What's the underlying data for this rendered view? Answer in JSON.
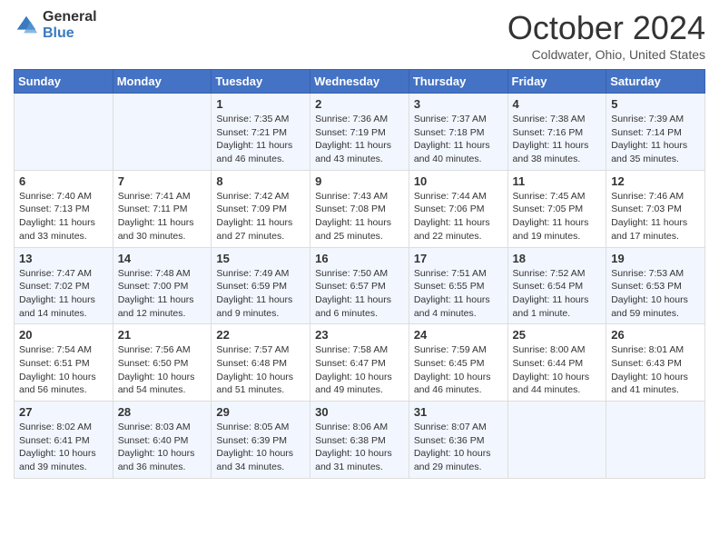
{
  "header": {
    "logo_general": "General",
    "logo_blue": "Blue",
    "title": "October 2024",
    "location": "Coldwater, Ohio, United States"
  },
  "days_of_week": [
    "Sunday",
    "Monday",
    "Tuesday",
    "Wednesday",
    "Thursday",
    "Friday",
    "Saturday"
  ],
  "weeks": [
    [
      {
        "day": "",
        "content": ""
      },
      {
        "day": "",
        "content": ""
      },
      {
        "day": "1",
        "content": "Sunrise: 7:35 AM\nSunset: 7:21 PM\nDaylight: 11 hours and 46 minutes."
      },
      {
        "day": "2",
        "content": "Sunrise: 7:36 AM\nSunset: 7:19 PM\nDaylight: 11 hours and 43 minutes."
      },
      {
        "day": "3",
        "content": "Sunrise: 7:37 AM\nSunset: 7:18 PM\nDaylight: 11 hours and 40 minutes."
      },
      {
        "day": "4",
        "content": "Sunrise: 7:38 AM\nSunset: 7:16 PM\nDaylight: 11 hours and 38 minutes."
      },
      {
        "day": "5",
        "content": "Sunrise: 7:39 AM\nSunset: 7:14 PM\nDaylight: 11 hours and 35 minutes."
      }
    ],
    [
      {
        "day": "6",
        "content": "Sunrise: 7:40 AM\nSunset: 7:13 PM\nDaylight: 11 hours and 33 minutes."
      },
      {
        "day": "7",
        "content": "Sunrise: 7:41 AM\nSunset: 7:11 PM\nDaylight: 11 hours and 30 minutes."
      },
      {
        "day": "8",
        "content": "Sunrise: 7:42 AM\nSunset: 7:09 PM\nDaylight: 11 hours and 27 minutes."
      },
      {
        "day": "9",
        "content": "Sunrise: 7:43 AM\nSunset: 7:08 PM\nDaylight: 11 hours and 25 minutes."
      },
      {
        "day": "10",
        "content": "Sunrise: 7:44 AM\nSunset: 7:06 PM\nDaylight: 11 hours and 22 minutes."
      },
      {
        "day": "11",
        "content": "Sunrise: 7:45 AM\nSunset: 7:05 PM\nDaylight: 11 hours and 19 minutes."
      },
      {
        "day": "12",
        "content": "Sunrise: 7:46 AM\nSunset: 7:03 PM\nDaylight: 11 hours and 17 minutes."
      }
    ],
    [
      {
        "day": "13",
        "content": "Sunrise: 7:47 AM\nSunset: 7:02 PM\nDaylight: 11 hours and 14 minutes."
      },
      {
        "day": "14",
        "content": "Sunrise: 7:48 AM\nSunset: 7:00 PM\nDaylight: 11 hours and 12 minutes."
      },
      {
        "day": "15",
        "content": "Sunrise: 7:49 AM\nSunset: 6:59 PM\nDaylight: 11 hours and 9 minutes."
      },
      {
        "day": "16",
        "content": "Sunrise: 7:50 AM\nSunset: 6:57 PM\nDaylight: 11 hours and 6 minutes."
      },
      {
        "day": "17",
        "content": "Sunrise: 7:51 AM\nSunset: 6:55 PM\nDaylight: 11 hours and 4 minutes."
      },
      {
        "day": "18",
        "content": "Sunrise: 7:52 AM\nSunset: 6:54 PM\nDaylight: 11 hours and 1 minute."
      },
      {
        "day": "19",
        "content": "Sunrise: 7:53 AM\nSunset: 6:53 PM\nDaylight: 10 hours and 59 minutes."
      }
    ],
    [
      {
        "day": "20",
        "content": "Sunrise: 7:54 AM\nSunset: 6:51 PM\nDaylight: 10 hours and 56 minutes."
      },
      {
        "day": "21",
        "content": "Sunrise: 7:56 AM\nSunset: 6:50 PM\nDaylight: 10 hours and 54 minutes."
      },
      {
        "day": "22",
        "content": "Sunrise: 7:57 AM\nSunset: 6:48 PM\nDaylight: 10 hours and 51 minutes."
      },
      {
        "day": "23",
        "content": "Sunrise: 7:58 AM\nSunset: 6:47 PM\nDaylight: 10 hours and 49 minutes."
      },
      {
        "day": "24",
        "content": "Sunrise: 7:59 AM\nSunset: 6:45 PM\nDaylight: 10 hours and 46 minutes."
      },
      {
        "day": "25",
        "content": "Sunrise: 8:00 AM\nSunset: 6:44 PM\nDaylight: 10 hours and 44 minutes."
      },
      {
        "day": "26",
        "content": "Sunrise: 8:01 AM\nSunset: 6:43 PM\nDaylight: 10 hours and 41 minutes."
      }
    ],
    [
      {
        "day": "27",
        "content": "Sunrise: 8:02 AM\nSunset: 6:41 PM\nDaylight: 10 hours and 39 minutes."
      },
      {
        "day": "28",
        "content": "Sunrise: 8:03 AM\nSunset: 6:40 PM\nDaylight: 10 hours and 36 minutes."
      },
      {
        "day": "29",
        "content": "Sunrise: 8:05 AM\nSunset: 6:39 PM\nDaylight: 10 hours and 34 minutes."
      },
      {
        "day": "30",
        "content": "Sunrise: 8:06 AM\nSunset: 6:38 PM\nDaylight: 10 hours and 31 minutes."
      },
      {
        "day": "31",
        "content": "Sunrise: 8:07 AM\nSunset: 6:36 PM\nDaylight: 10 hours and 29 minutes."
      },
      {
        "day": "",
        "content": ""
      },
      {
        "day": "",
        "content": ""
      }
    ]
  ]
}
